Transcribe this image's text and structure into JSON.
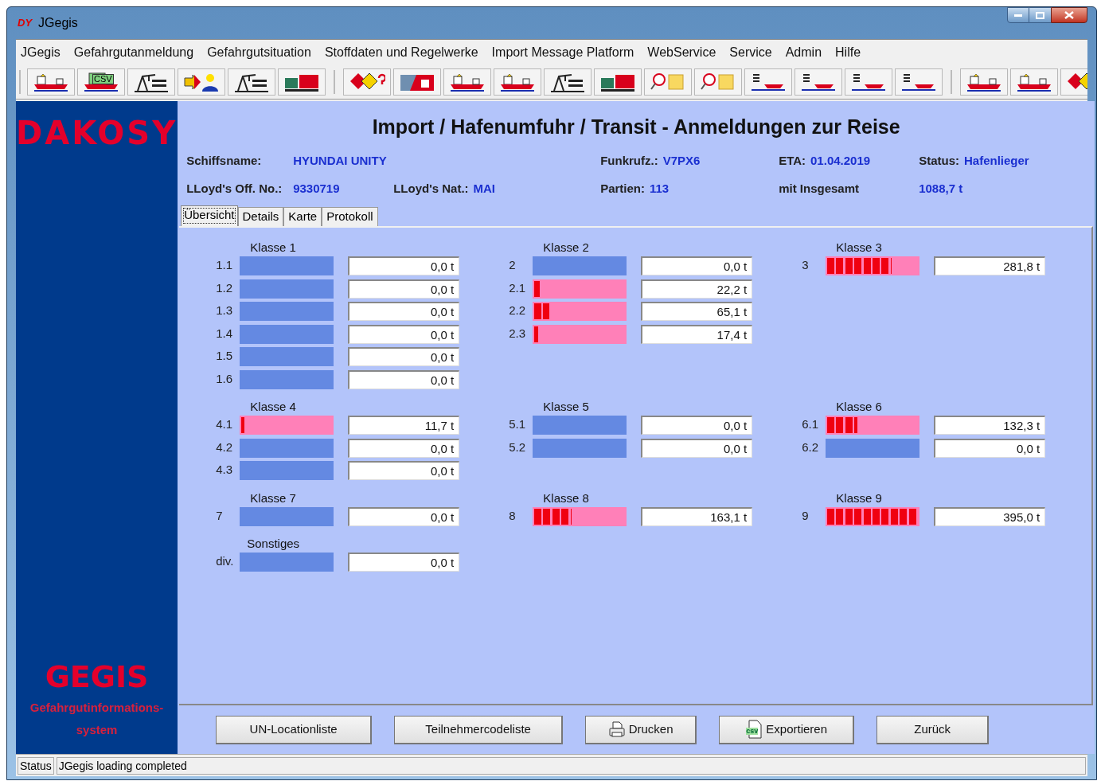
{
  "window": {
    "logo": "DY",
    "title": "JGegis"
  },
  "menu": [
    "JGegis",
    "Gefahrgutanmeldung",
    "Gefahrgutsituation",
    "Stoffdaten und Regelwerke",
    "Import Message Platform",
    "WebService",
    "Service",
    "Admin",
    "Hilfe"
  ],
  "toolbar": [
    [
      {
        "kind": "ship"
      },
      {
        "kind": "csv",
        "label": "CSV"
      },
      {
        "kind": "crane"
      },
      {
        "kind": "person"
      },
      {
        "kind": "crane"
      },
      {
        "kind": "truck"
      }
    ],
    [
      {
        "kind": "hazard"
      },
      {
        "kind": "port"
      },
      {
        "kind": "ship"
      },
      {
        "kind": "ship"
      },
      {
        "kind": "crane"
      },
      {
        "kind": "truck"
      },
      {
        "kind": "search"
      },
      {
        "kind": "search"
      },
      {
        "kind": "list"
      },
      {
        "kind": "list"
      },
      {
        "kind": "list"
      },
      {
        "kind": "list"
      }
    ],
    [
      {
        "kind": "ship"
      },
      {
        "kind": "ship"
      },
      {
        "kind": "hazard"
      }
    ]
  ],
  "sidebar": {
    "brand": "DAKOSY",
    "product": "GEGIS",
    "subtitle": "Gefahrgutinformations-system"
  },
  "heading": "Import / Hafenumfuhr / Transit - Anmeldungen zur Reise",
  "info_lines": [
    [
      {
        "label": "Schiffsname:"
      },
      {
        "value": "HYUNDAI UNITY"
      },
      {
        "label": "Funkrufz.:",
        "value": "V7PX6"
      },
      {
        "label": "ETA:",
        "value": "01.04.2019"
      },
      {
        "label": "Status:",
        "value": "Hafenlieger"
      }
    ],
    [
      {
        "label": "LLoyd's Off. No.:",
        "value": "9330719"
      },
      {
        "label": "LLoyd's Nat.:",
        "value": "MAI"
      },
      {
        "label": "Partien:",
        "value": "113"
      },
      {
        "label": "mit Insgesamt"
      },
      {
        "value": "1088,7 t"
      }
    ]
  ],
  "tabs": [
    {
      "label": "Übersicht",
      "selected": true
    },
    {
      "label": "Details",
      "selected": false
    },
    {
      "label": "Karte",
      "selected": false
    },
    {
      "label": "Protokoll",
      "selected": false
    }
  ],
  "class_rows": [
    [
      {
        "title": "Klasse 1",
        "items": [
          {
            "code": "1.1",
            "level": 0,
            "amount": "0,0 t"
          },
          {
            "code": "1.2",
            "level": 0,
            "amount": "0,0 t"
          },
          {
            "code": "1.3",
            "level": 0,
            "amount": "0,0 t"
          },
          {
            "code": "1.4",
            "level": 0,
            "amount": "0,0 t"
          },
          {
            "code": "1.5",
            "level": 0,
            "amount": "0,0 t"
          },
          {
            "code": "1.6",
            "level": 0,
            "amount": "0,0 t"
          }
        ]
      },
      {
        "title": "Klasse 2",
        "items": [
          {
            "code": "2",
            "level": 0,
            "amount": "0,0 t"
          },
          {
            "code": "2.1",
            "level": 0.056,
            "amount": "22,2 t"
          },
          {
            "code": "2.2",
            "level": 0.165,
            "amount": "65,1 t"
          },
          {
            "code": "2.3",
            "level": 0.044,
            "amount": "17,4 t"
          }
        ]
      },
      {
        "title": "Klasse 3",
        "items": [
          {
            "code": "3",
            "level": 0.71,
            "amount": "281,8 t"
          }
        ]
      }
    ],
    [
      {
        "title": "Klasse 4",
        "items": [
          {
            "code": "4.1",
            "level": 0.03,
            "amount": "11,7 t"
          },
          {
            "code": "4.2",
            "level": 0,
            "amount": "0,0 t"
          },
          {
            "code": "4.3",
            "level": 0,
            "amount": "0,0 t"
          }
        ]
      },
      {
        "title": "Klasse 5",
        "items": [
          {
            "code": "5.1",
            "level": 0,
            "amount": "0,0 t"
          },
          {
            "code": "5.2",
            "level": 0,
            "amount": "0,0 t"
          }
        ]
      },
      {
        "title": "Klasse 6",
        "items": [
          {
            "code": "6.1",
            "level": 0.33,
            "amount": "132,3 t"
          },
          {
            "code": "6.2",
            "level": 0,
            "amount": "0,0 t"
          }
        ]
      }
    ],
    [
      {
        "title": "Klasse 7",
        "items": [
          {
            "code": "7",
            "level": 0,
            "amount": "0,0 t"
          }
        ]
      },
      {
        "title": "Klasse 8",
        "items": [
          {
            "code": "8",
            "level": 0.41,
            "amount": "163,1 t"
          }
        ]
      },
      {
        "title": "Klasse 9",
        "items": [
          {
            "code": "9",
            "level": 1,
            "amount": "395,0 t"
          }
        ]
      }
    ],
    [
      {
        "title": "Sonstiges",
        "items": [
          {
            "code": "div.",
            "level": 0,
            "amount": "0,0 t"
          }
        ]
      }
    ]
  ],
  "buttons": [
    {
      "label": "UN-Locationliste"
    },
    {
      "label": "Teilnehmercodeliste"
    },
    {
      "label": "Drucken",
      "kind": "print"
    },
    {
      "label": "Exportieren",
      "kind": "export",
      "icon_text": "csv"
    },
    {
      "label": "Zurück"
    }
  ],
  "status_bar": {
    "label": "Status",
    "message": "JGegis loading completed"
  }
}
